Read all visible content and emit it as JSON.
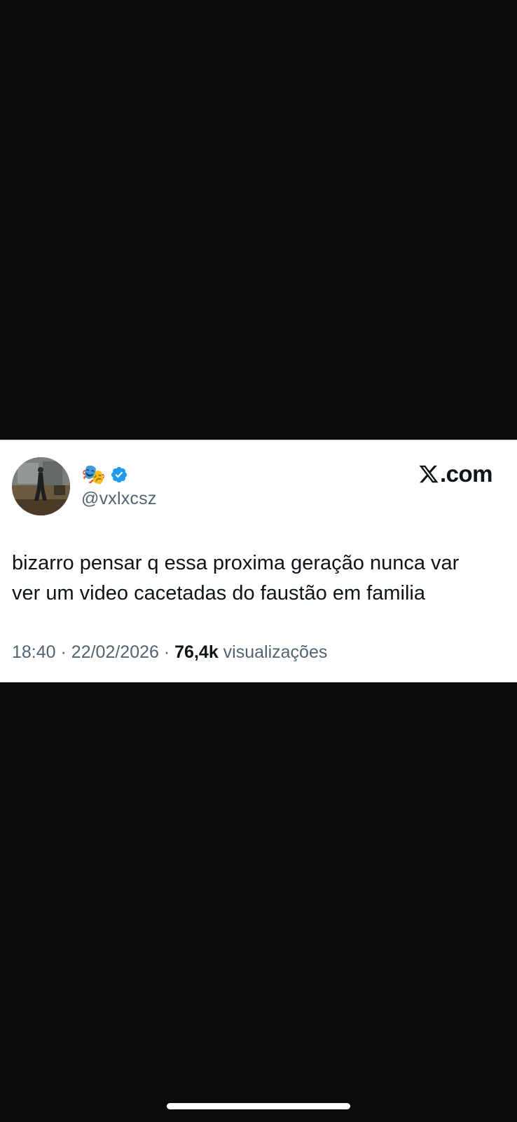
{
  "tweet": {
    "display_name_emoji": "🎭",
    "handle": "@vxlxcsz",
    "verified": true,
    "verified_icon": "verified-badge-icon",
    "brand_text": ".com",
    "brand_icon": "x-logo-icon",
    "text_line_1": "bizarro pensar q essa proxima geração nunca var",
    "text_line_2": "ver um video cacetadas do faustão em familia",
    "time": "18:40",
    "separator": "·",
    "date": "22/02/2026",
    "views_count": "76,4k",
    "views_label": "visualizações"
  },
  "colors": {
    "background": "#0b0b0c",
    "card": "#ffffff",
    "text_primary": "#0f1419",
    "text_secondary": "#536471",
    "verified_blue": "#1d9bf0"
  }
}
